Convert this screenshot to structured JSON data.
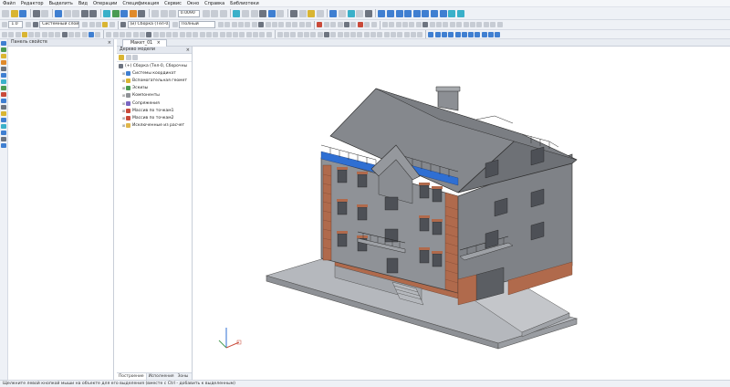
{
  "menu": [
    "Файл",
    "Редактор",
    "Выделить",
    "Вид",
    "Операции",
    "Спецификация",
    "Сервис",
    "Окно",
    "Справка",
    "Библиотеки"
  ],
  "toolbar": {
    "zoom_value": "0.0090",
    "line_scale": "1.0",
    "layer_combo": "Системный слой (0)",
    "assembly_combo": "(и) Сборка (Тел-0...",
    "style_combo": "Полный"
  },
  "properties_panel": {
    "title": "Панель свойств"
  },
  "document_tab": {
    "label": "Макет_01"
  },
  "model_tree": {
    "title": "Дерево модели",
    "root": "(+) Сборка (Тел-0, Сборочны",
    "items": [
      "Системы координат",
      "Вспомогательная геомет",
      "Эскизы",
      "Компоненты",
      "Сопряжения",
      "Массив по точкам1",
      "Массив по точкам2",
      "Исключенные из расчет"
    ],
    "tabs": [
      "Построение",
      "Исполнения",
      "Зоны"
    ]
  },
  "status_bar": "Щелкните левой кнопкой мыши на объекте для его выделения (вместе с Ctrl - добавить к выделенным)",
  "colors": {
    "accent": "#3f7fd1",
    "brick": "#b06a4c",
    "wall": "#8f9297",
    "roof": "#7b7e83",
    "glass": "#2f6fd3"
  },
  "icons": {
    "gizmo": "coordinate-axes-icon"
  }
}
